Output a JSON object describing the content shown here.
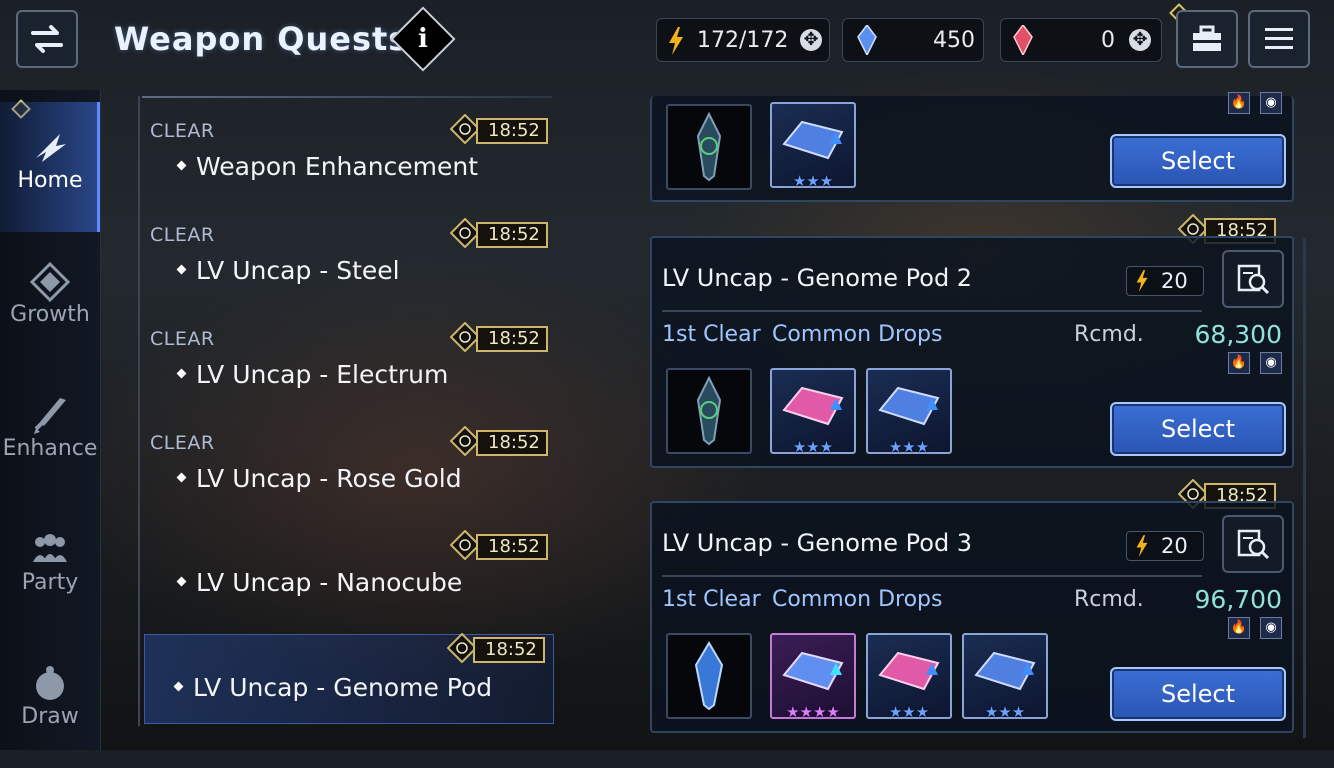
{
  "header": {
    "title": "Weapon Quests",
    "info_icon": "i",
    "stamina": "172/172",
    "crystals": "450",
    "gems": "0",
    "plus_symbol": "✥"
  },
  "nav": {
    "items": [
      {
        "label": "Home",
        "icon": "home-icon",
        "active": true
      },
      {
        "label": "Growth",
        "icon": "growth-icon",
        "active": false
      },
      {
        "label": "Enhance",
        "icon": "sword-icon",
        "active": false
      },
      {
        "label": "Party",
        "icon": "party-icon",
        "active": false
      },
      {
        "label": "Draw",
        "icon": "moogle-icon",
        "active": false
      }
    ]
  },
  "quest_list": [
    {
      "status": "CLEAR",
      "name": "Weapon Enhancement",
      "timer": "18:52"
    },
    {
      "status": "CLEAR",
      "name": "LV Uncap - Steel",
      "timer": "18:52"
    },
    {
      "status": "CLEAR",
      "name": "LV Uncap - Electrum",
      "timer": "18:52"
    },
    {
      "status": "CLEAR",
      "name": "LV Uncap - Rose Gold",
      "timer": "18:52"
    },
    {
      "status": "",
      "name": "LV Uncap - Nanocube",
      "timer": "18:52"
    },
    {
      "status": "",
      "name": "LV Uncap - Genome Pod",
      "timer": "18:52",
      "selected": true
    }
  ],
  "cards": [
    {
      "title": "",
      "select_label": "Select",
      "stars": [
        "★★★"
      ]
    },
    {
      "title": "LV Uncap - Genome Pod 2",
      "timer": "18:52",
      "stamina": "20",
      "first_clear": "1st Clear",
      "common_drops": "Common Drops",
      "rcmd_label": "Rcmd.",
      "rcmd_value": "68,300",
      "select_label": "Select",
      "stars": [
        "★★★",
        "★★★"
      ]
    },
    {
      "title": "LV Uncap - Genome Pod 3",
      "timer": "18:52",
      "stamina": "20",
      "first_clear": "1st Clear",
      "common_drops": "Common Drops",
      "rcmd_label": "Rcmd.",
      "rcmd_value": "96,700",
      "select_label": "Select",
      "stars": [
        "★★★★",
        "★★★",
        "★★★"
      ]
    }
  ],
  "colors": {
    "accent": "#3b6fd4",
    "gold": "#cdb66a",
    "rcmd": "#8fe2d9"
  }
}
